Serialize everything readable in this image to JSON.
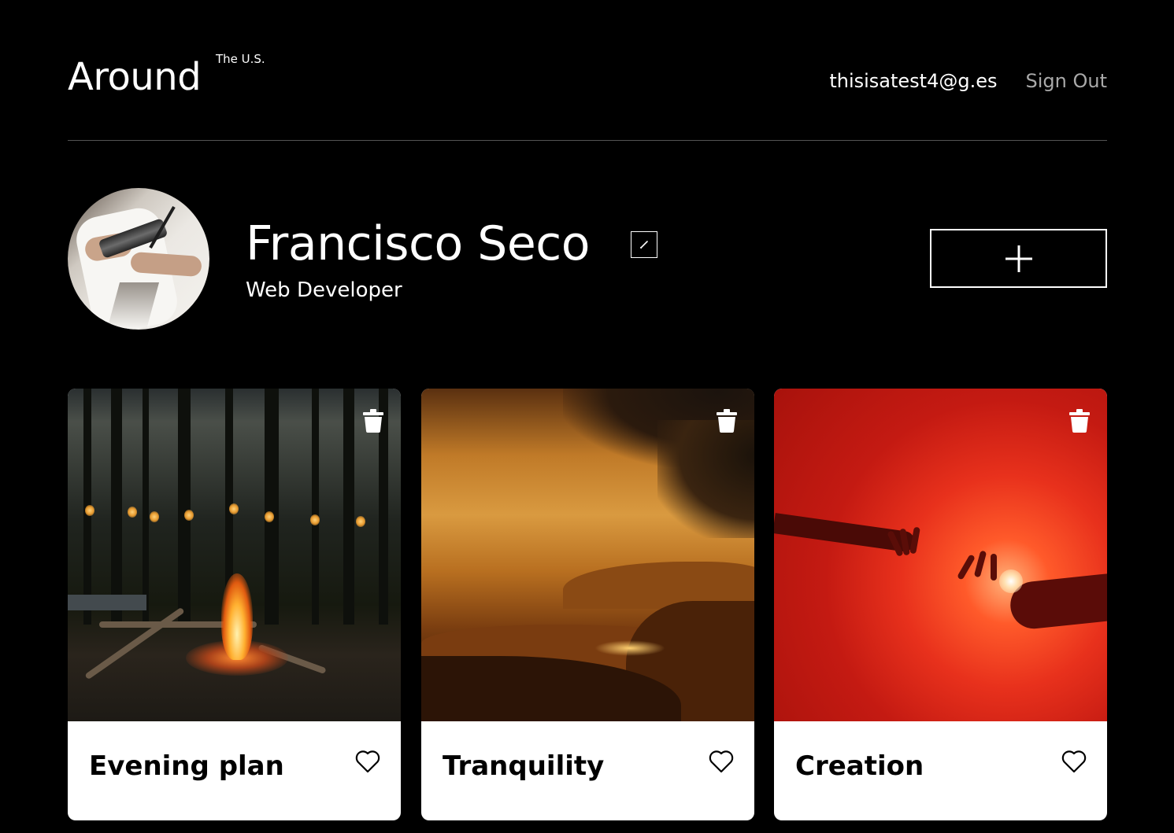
{
  "header": {
    "logo": "Around",
    "logo_sup": "The U.S.",
    "email": "thisisatest4@g.es",
    "sign_out": "Sign Out"
  },
  "profile": {
    "name": "Francisco Seco",
    "job": "Web Developer"
  },
  "cards": [
    {
      "title": "Evening plan"
    },
    {
      "title": "Tranquility"
    },
    {
      "title": "Creation"
    }
  ]
}
